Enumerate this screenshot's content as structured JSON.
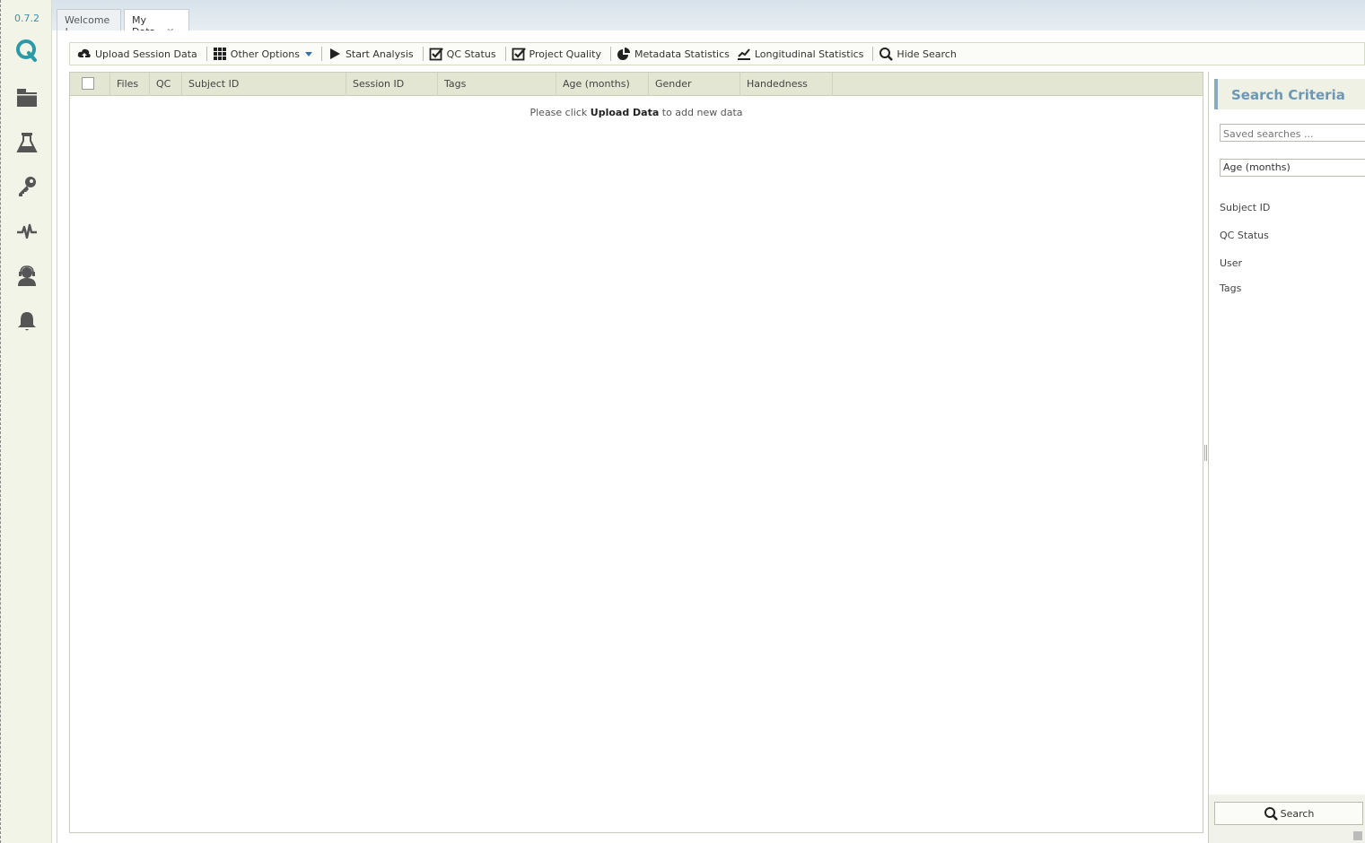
{
  "app": {
    "version": "0.7.2"
  },
  "sidebar": {
    "icons": [
      "logo-q-icon",
      "folder-icon",
      "flask-icon",
      "key-icon",
      "pulse-icon",
      "support-icon",
      "bell-icon"
    ]
  },
  "tabs": [
    {
      "label": "Welcome !"
    },
    {
      "label": "My Data",
      "close": "✕"
    }
  ],
  "toolbar": {
    "upload": "Upload Session Data",
    "other_options": "Other Options",
    "start_analysis": "Start Analysis",
    "qc_status": "QC Status",
    "project_quality": "Project Quality",
    "metadata_statistics": "Metadata Statistics",
    "longitudinal_statistics": "Longitudinal Statistics",
    "hide_search": "Hide Search"
  },
  "grid": {
    "columns": [
      "Files",
      "QC",
      "Subject ID",
      "Session ID",
      "Tags",
      "Age (months)",
      "Gender",
      "Handedness"
    ],
    "empty_prefix": "Please click ",
    "empty_bold": "Upload Data",
    "empty_suffix": " to add new data"
  },
  "search": {
    "title": "Search Criteria",
    "saved_placeholder": "Saved searches ...",
    "age_value": "Age (months)",
    "fields": [
      "Subject ID",
      "QC Status",
      "User",
      "Tags"
    ],
    "button": "Search"
  },
  "colors": {
    "accent": "#3a8fa8",
    "header_bg": "#e2e6d2",
    "sidebar_bg": "#f1f4e6"
  }
}
